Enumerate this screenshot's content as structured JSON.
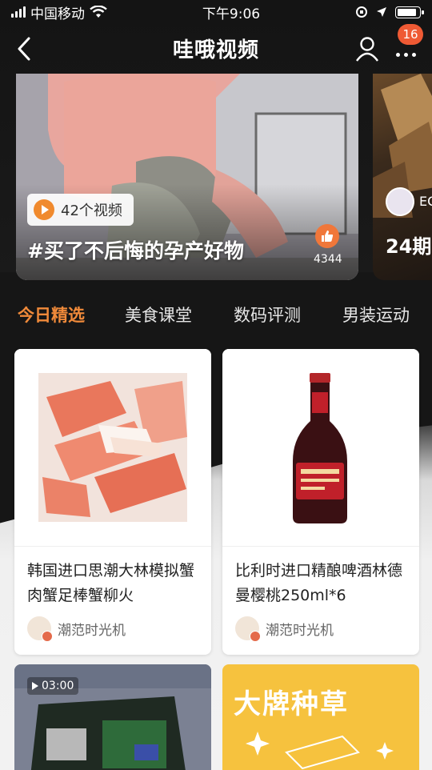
{
  "status_bar": {
    "carrier": "中国移动",
    "time": "下午9:06",
    "battery_level": 0.9
  },
  "nav": {
    "title": "哇哦视频",
    "notification_count": "16",
    "icons": [
      "back-icon",
      "user-icon",
      "more-icon"
    ]
  },
  "banners": [
    {
      "video_count": "42个视频",
      "title": "#买了不后悔的孕产好物",
      "like_count": "4344"
    },
    {
      "tag": "EC",
      "title": "24期"
    }
  ],
  "tabs": [
    "今日精选",
    "美食课堂",
    "数码评测",
    "男装运动"
  ],
  "products": [
    {
      "title": "韩国进口思潮大林模拟蟹肉蟹足棒蟹柳火",
      "author": "潮范时光机"
    },
    {
      "title": "比利时进口精酿啤酒林德曼樱桃250ml*6",
      "author": "潮范时光机"
    }
  ],
  "bottom_cards": [
    {
      "duration": "03:00"
    },
    {
      "promo": "大牌种草"
    }
  ],
  "colors": {
    "accent": "#f08a3a",
    "badge": "#ef5a34",
    "promo_yellow": "#f6c23e"
  }
}
